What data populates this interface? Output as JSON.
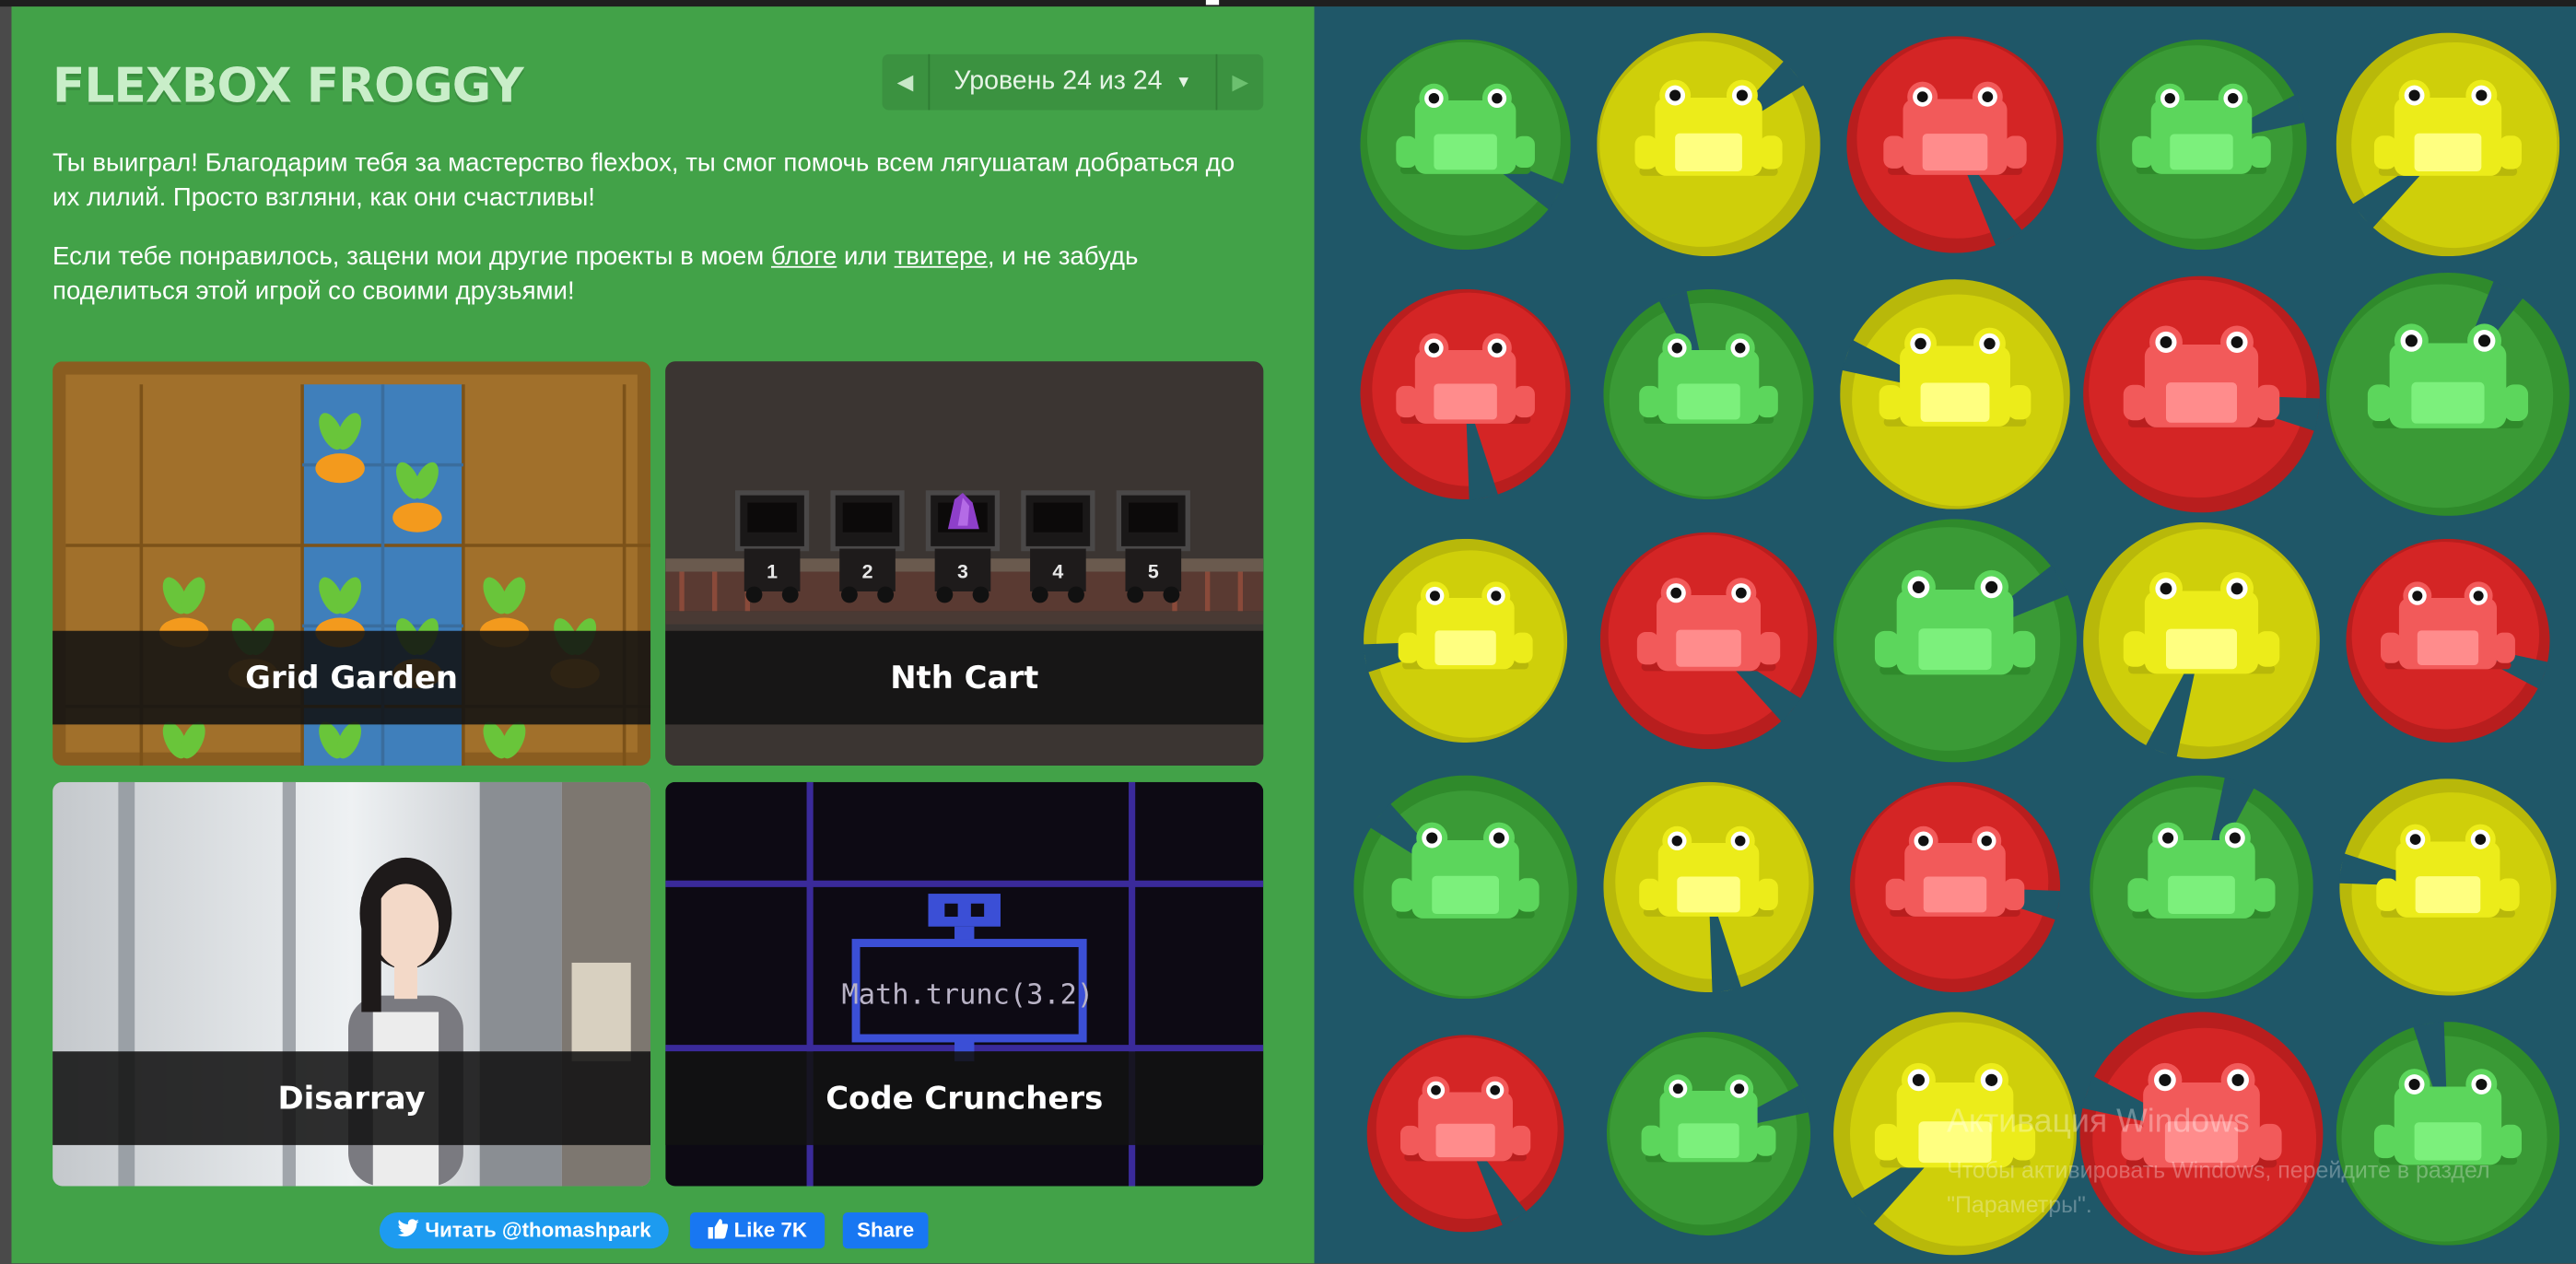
{
  "header": {
    "title": "FLEXBOX FROGGY",
    "level_label": "Уровень 24 из 24",
    "caret": "▼",
    "prev_icon": "◀",
    "next_icon": "▶"
  },
  "message": {
    "paragraph1": "Ты выиграл! Благодарим тебя за мастерство flexbox, ты смог помочь всем лягушатам добраться до их лилий. Просто взгляни, как они счастливы!",
    "p2_before": "Если тебе понравилось, зацени мои другие проекты в моем ",
    "p2_link1": "блоге",
    "p2_middle": " или ",
    "p2_link2": "твитере",
    "p2_after": ", и не забудь поделиться этой игрой со своими друзьями!"
  },
  "projects": [
    {
      "label": "Grid Garden"
    },
    {
      "label": "Nth Cart"
    },
    {
      "label": "Disarray"
    },
    {
      "label": "Code Crunchers"
    }
  ],
  "nth_cart_numbers": [
    "1",
    "2",
    "3",
    "4",
    "5"
  ],
  "code_crunchers_code": "Math.trunc(3.2)",
  "social": {
    "twitter": "Читать @thomashpark",
    "like": "Like 7K",
    "share": "Share"
  },
  "frog_grid": [
    [
      "green",
      "yellow",
      "red",
      "green",
      "yellow"
    ],
    [
      "red",
      "green",
      "yellow",
      "red",
      "green"
    ],
    [
      "yellow",
      "red",
      "green",
      "yellow",
      "red"
    ],
    [
      "green",
      "yellow",
      "red",
      "green",
      "yellow"
    ],
    [
      "red",
      "green",
      "yellow",
      "red",
      "green"
    ]
  ],
  "colors": {
    "sidebar": "#42a248",
    "pond": "#1f5768",
    "green_pad": "#3a9a36",
    "yellow_pad": "#cfcf0a",
    "red_pad": "#d42525",
    "green_frog": "#5cd65c",
    "yellow_frog": "#ecec1a",
    "red_frog": "#f25a5a",
    "twitter": "#1d9bf0",
    "facebook": "#1877f2"
  },
  "watermark": {
    "title": "Активация Windows",
    "subtitle": "Чтобы активировать Windows, перейдите в раздел \"Параметры\"."
  }
}
